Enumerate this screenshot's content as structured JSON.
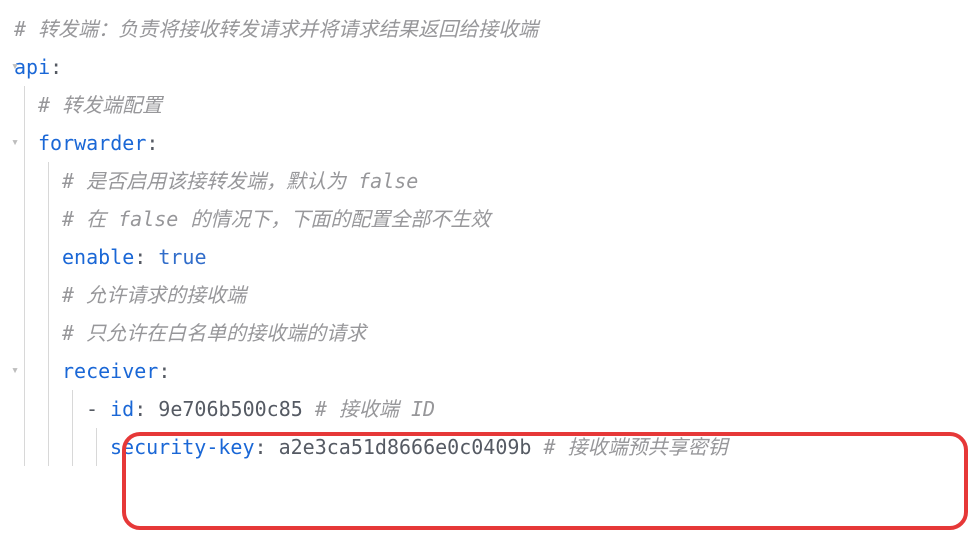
{
  "code": {
    "line1_comment": "# 转发端：负责将接收转发请求并将请求结果返回给接收端",
    "line2_key": "api",
    "line3_comment": "# 转发端配置",
    "line4_key": "forwarder",
    "line5_comment": "# 是否启用该接转发端，默认为 false",
    "line6_comment": "# 在 false 的情况下，下面的配置全部不生效",
    "line7_key": "enable",
    "line7_value": "true",
    "line8_comment": "# 允许请求的接收端",
    "line9_comment": "# 只允许在白名单的接收端的请求",
    "line10_key": "receiver",
    "line11_dash": "- ",
    "line11_key": "id",
    "line11_value": "9e706b500c85",
    "line11_comment": "# 接收端 ID",
    "line12_key": "security-key",
    "line12_value": "a2e3ca51d8666e0c0409b",
    "line12_comment": "# 接收端预共享密钥"
  },
  "colon": ":",
  "colon_sp": ": "
}
